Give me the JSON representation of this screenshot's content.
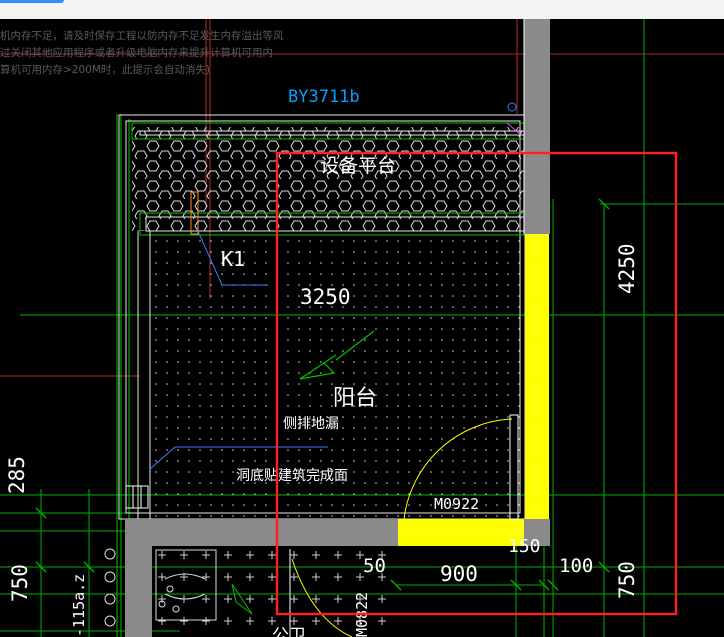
{
  "banner": {
    "lines": [
      "机内存不足，请及时保存工程以防内存不足发生内存溢出等风",
      "过关闭其他应用程序或者升级电脑内存来提升计算机可用内",
      "算机可用内存>200M时，此提示会自动消失)"
    ]
  },
  "drawing": {
    "tag": "BY3711b",
    "equipment_platform": "设备平台",
    "window_label": "K1",
    "dim_width": "3250",
    "dim_height": "4250",
    "balcony": "阳台",
    "side_drain": "侧排地漏",
    "hole_note": "洞底贴建筑完成面",
    "door_code": "M0922",
    "dim_150": "150",
    "dim_50": "50",
    "dim_900": "900",
    "dim_100": "100",
    "dim_750_right": "750",
    "dim_750_left": "750",
    "dim_285": "285",
    "level_note": "-115a.z",
    "door_code_lower": "M0822",
    "room_partial": "公卫"
  },
  "colors": {
    "background": "#000000",
    "selection_box": "#ff2020",
    "wall": "#808080",
    "highlight": "#ffff00",
    "dimension": "#00c000",
    "tag": "#00a0ff",
    "text": "#ffffff"
  }
}
